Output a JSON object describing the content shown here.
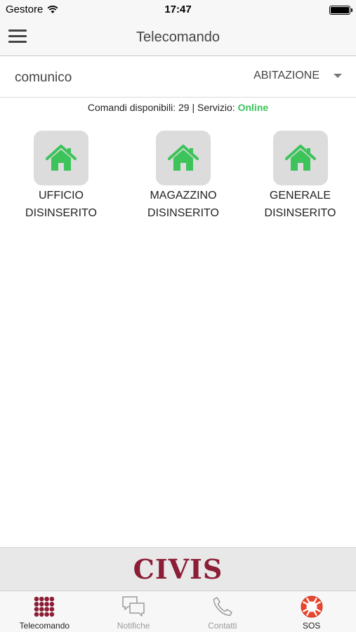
{
  "status_bar": {
    "carrier": "Gestore",
    "time": "17:47"
  },
  "nav": {
    "title": "Telecomando"
  },
  "selector": {
    "user": "comunico",
    "zone": "ABITAZIONE"
  },
  "info": {
    "prefix": "Comandi disponibili: 29 | Servizio: ",
    "service_status": "Online"
  },
  "commands": [
    {
      "line1": "UFFICIO",
      "line2": "DISINSERITO"
    },
    {
      "line1": "MAGAZZINO",
      "line2": "DISINSERITO"
    },
    {
      "line1": "GENERALE",
      "line2": "DISINSERITO"
    }
  ],
  "brand": {
    "logo_text": "CIVIS"
  },
  "tabs": [
    {
      "label": "Telecomando",
      "icon": "keypad-icon",
      "active": true
    },
    {
      "label": "Notifiche",
      "icon": "chat-icon",
      "active": false
    },
    {
      "label": "Contatti",
      "icon": "phone-icon",
      "active": false
    },
    {
      "label": "SOS",
      "icon": "lifebuoy-icon",
      "active": false
    }
  ],
  "colors": {
    "accent": "#8b1d36",
    "online": "#3cc35a",
    "house": "#3cc35a",
    "sos": "#e8472e"
  }
}
